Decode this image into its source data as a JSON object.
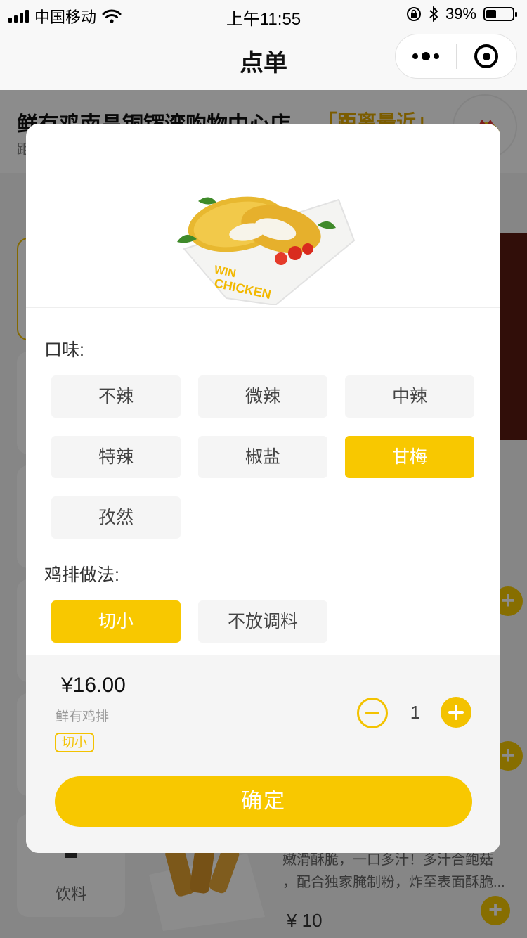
{
  "status_bar": {
    "carrier": "中国移动",
    "time": "上午11:55",
    "battery": "39%",
    "battery_level": 0.39
  },
  "nav": {
    "title": "点单"
  },
  "store": {
    "name": "鲜有鸡南昌铜锣湾购物中心店",
    "tag": "「距离最近」",
    "distance_prefix": "距"
  },
  "background": {
    "category_label": "饮料",
    "desc_line1": "嫩滑酥脆，一口多汁！多汁合鲍菇",
    "desc_line2": "，配合独家腌制粉，炸至表面酥脆...",
    "price": "¥ 10"
  },
  "modal": {
    "flavor_label": "口味:",
    "flavor_options": [
      {
        "label": "不辣",
        "selected": false
      },
      {
        "label": "微辣",
        "selected": false
      },
      {
        "label": "中辣",
        "selected": false
      },
      {
        "label": "特辣",
        "selected": false
      },
      {
        "label": "椒盐",
        "selected": false
      },
      {
        "label": "甘梅",
        "selected": true
      },
      {
        "label": "孜然",
        "selected": false
      }
    ],
    "method_label": "鸡排做法:",
    "method_options": [
      {
        "label": "切小",
        "selected": true
      },
      {
        "label": "不放调料",
        "selected": false
      }
    ],
    "image_text": "WIN CHICKEN"
  },
  "footer": {
    "price": "¥16.00",
    "item_name": "鲜有鸡排",
    "selected_tag": "切小",
    "quantity": "1",
    "confirm_label": "确定"
  },
  "colors": {
    "accent": "#f8c800",
    "option_bg": "#f5f5f5"
  }
}
